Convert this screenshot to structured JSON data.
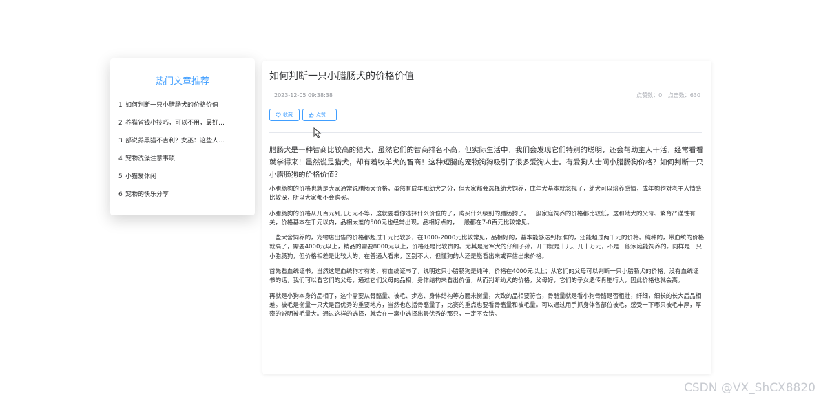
{
  "sidebar": {
    "title": "热门文章推荐",
    "items": [
      {
        "num": "1",
        "label": "如何判断一只小腊肠犬的价格价值"
      },
      {
        "num": "2",
        "label": "养猫省钱小技巧，可以不用，最好…"
      },
      {
        "num": "3",
        "label": "部说养黑猫不吉利？女巫：这些人…"
      },
      {
        "num": "4",
        "label": "宠物洗澡注意事项"
      },
      {
        "num": "5",
        "label": "小猫爱休闲"
      },
      {
        "num": "6",
        "label": "宠物的快乐分享"
      }
    ]
  },
  "article": {
    "title": "如何判断一只小腊肠犬的价格价值",
    "date": "2023-12-05 09:38:38",
    "likes_text": "点赞数：0",
    "views_text": "点击数：630",
    "favorite_label": "收藏",
    "like_label": "点赞",
    "intro": "腊肠犬是一种智商比较高的猎犬，虽然它们的智商排名不高，但实际生活中，我们会发现它们特别的聪明，还会帮助主人干活，经常看看就学得来！虽然说是猎犬，却有着牧羊犬的智商！这种短腿的宠物狗狗吸引了很多爱狗人士。有爱狗人士问小腊肠狗价格？如何判断一只小腊肠狗的价格价值？",
    "paragraphs": [
      "小腊肠狗的价格也就是大家通常说腊肠犬价格，虽然有成年和幼犬之分，但大家都会选择幼犬饲养，成年犬基本就忽视了，幼犬可以培养感情，成年狗狗对老主人情感比较深，所以大家都不会购买。",
      "小腊肠狗的价格从几百元到几万元不等，这就要看你选择什么价位的了，购买什么级别的腊肠狗了。一般家庭饲养的价格都比较低，这和幼犬的父母、繁育严谨性有关，价格基本在千元以内，品相太差的500元也经常出现。品相好点的，一般都在7-8百元比较常见。",
      "一些犬舍饲养的，宠物店出售的价格都超过千元比较多，在1000-2000元比较常见，品相好的，基本能够达到标准的，还能超过两千元的价格。纯种的，带血统的价格就高了，需要4000元以上，精品的需要8000元以上，价格还是比较贵的。尤其是冠军犬的仔细子孙，开口就是十几、几十万元，不是一般家庭能饲养的。同样是一只小腊肠狗，但价格相差是比较大的，在普通人看来，区别不大，但懂狗的人还是能看出来或评估出来价格。",
      "首先看血统证书，当然这是血统狗才有的，有血统证书了，说明这只小腊肠狗是纯种，价格在4000元以上；从它们的父母可以判断一只小腊肠犬的价格，没有血统证书的话，我们可以看它们的父母，通过它们父母的品相，身体结构来看出价值，从而判断幼犬的价格，父母好，它们的子女遗传肯能行大，因此价格也就会高。",
      "再就是小狗本身的品相了，这个需要从骨骼量、被毛、步态、身体结构等方面来衡量，大致的品相要符合，骨骼量就是看小狗骨骼是否粗壮，纤细，细长的长大后品相差。被毛是衡量一只犬是否优秀的重要地方，当然也包括骨骼量了，比赛的重点也要看骨骼量和被毛量。可以通过用手抓身体各部位被毛，感受一下哪只被毛丰厚，厚密的说明被毛量大。通过这样的选择，就会在一窝中选择出最优秀的那只，一定不会错。"
    ]
  },
  "watermark": "CSDN @VX_ShCX8820",
  "colors": {
    "accent": "#409eff",
    "text": "#303133",
    "muted": "#909399"
  }
}
